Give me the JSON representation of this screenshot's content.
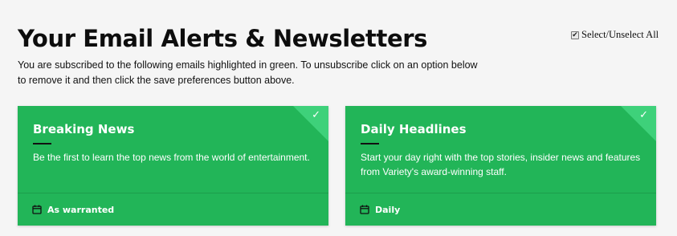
{
  "header": {
    "title": "Your Email Alerts & Newsletters",
    "select_all_label": "Select/Unselect All",
    "select_all_checked": true,
    "intro": "You are subscribed to the following emails highlighted in green. To unsubscribe click on an option below to remove it and then click the save preferences button above."
  },
  "colors": {
    "card_selected": "#22b558",
    "corner_badge": "#3ed17a",
    "title_text": "#0d0d0d"
  },
  "newsletters": [
    {
      "name": "Breaking News",
      "description": "Be the first to learn the top news from the world of entertainment.",
      "frequency": "As warranted",
      "selected": true,
      "icon": "calendar-icon"
    },
    {
      "name": "Daily Headlines",
      "description": "Start your day right with the top stories, insider news and features from Variety's award-winning staff.",
      "frequency": "Daily",
      "selected": true,
      "icon": "calendar-icon"
    }
  ]
}
